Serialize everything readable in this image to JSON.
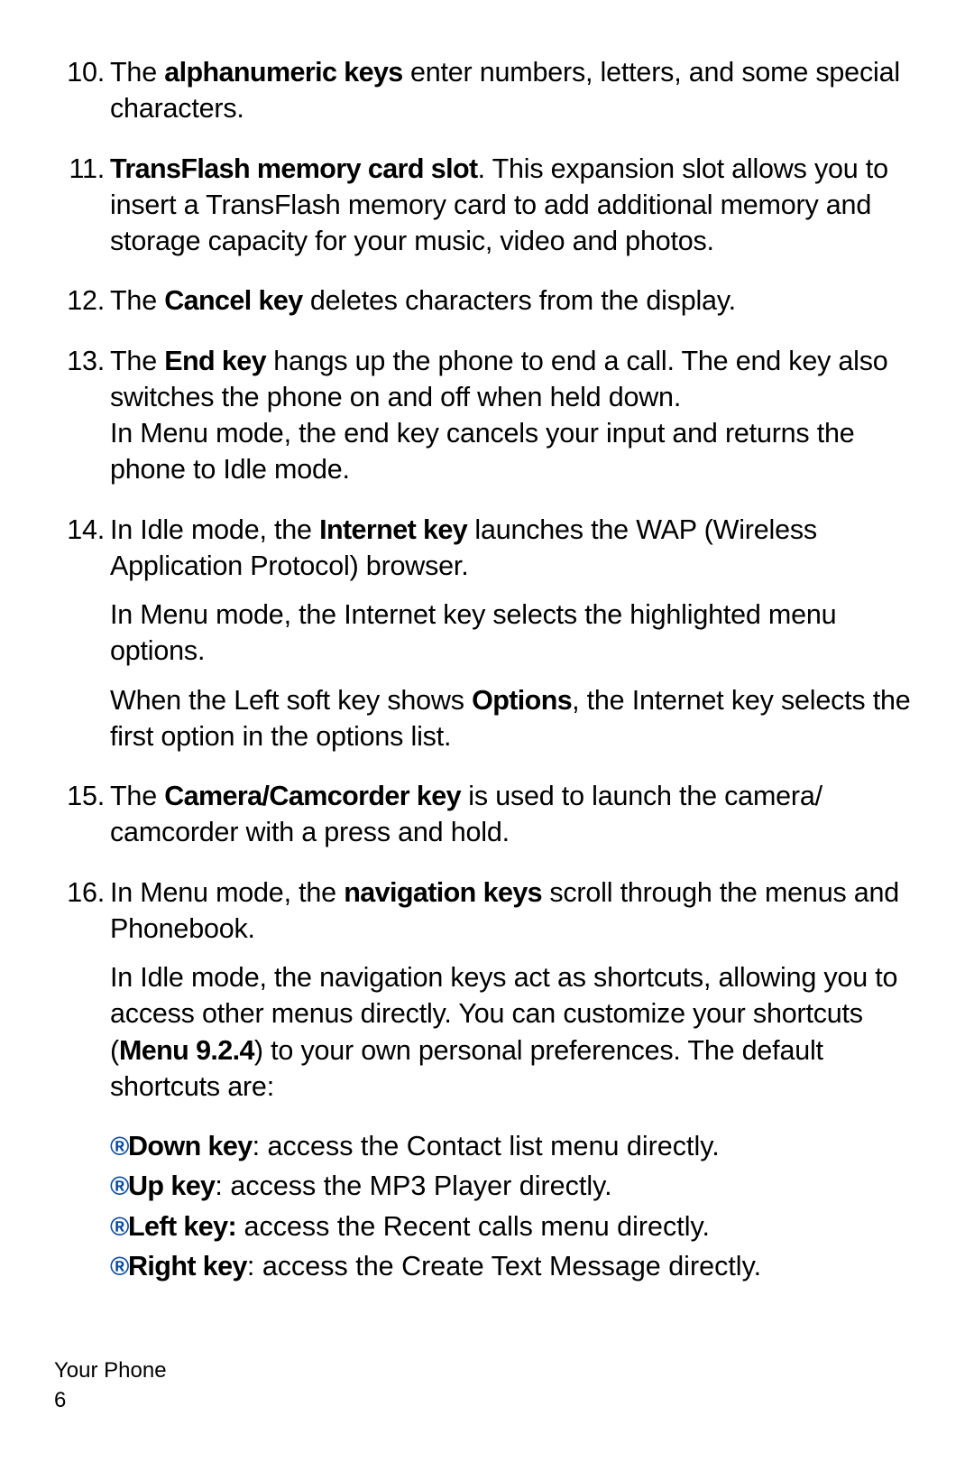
{
  "items": [
    {
      "num": 10,
      "frags": [
        {
          "t": "The "
        },
        {
          "t": "alphanumeric keys",
          "b": true,
          "cond": true
        },
        {
          "t": " enter numbers, letters, and some special characters."
        }
      ]
    },
    {
      "num": 11,
      "frags": [
        {
          "t": "TransFlash memory card slot",
          "b": true,
          "cond": true
        },
        {
          "t": ". This expansion slot allows you to insert a TransFlash memory card to add additional memory and storage capacity for your music, video and photos."
        }
      ]
    },
    {
      "num": 12,
      "frags": [
        {
          "t": "The "
        },
        {
          "t": "Cancel key",
          "b": true,
          "cond": true
        },
        {
          "t": " deletes characters from the display."
        }
      ]
    },
    {
      "num": 13,
      "frags": [
        {
          "t": "The "
        },
        {
          "t": "End key",
          "b": true,
          "cond": true
        },
        {
          "t": " hangs up the phone to end a call. The end key also switches the phone on and off when held down."
        },
        {
          "br": true
        },
        {
          "t": "In Menu mode, the end key cancels your input and returns the phone to Idle mode."
        }
      ]
    },
    {
      "num": 14,
      "frags": [
        {
          "t": "In Idle mode, the "
        },
        {
          "t": "Internet key",
          "b": true,
          "cond": true
        },
        {
          "t": " launches the WAP (Wireless Application Protocol) browser."
        }
      ],
      "paras": [
        [
          {
            "t": "In Menu mode, the Internet key selects the highlighted menu options."
          }
        ],
        [
          {
            "t": "When the Left soft key shows "
          },
          {
            "t": "Options",
            "b": true,
            "cond": true
          },
          {
            "t": ", the Internet key selects the first option in the options list."
          }
        ]
      ]
    },
    {
      "num": 15,
      "frags": [
        {
          "t": "The "
        },
        {
          "t": "Camera/Camcorder key",
          "b": true,
          "cond": true
        },
        {
          "t": " is used to launch the camera/"
        },
        {
          "br": true
        },
        {
          "t": "camcorder with a press and hold."
        }
      ]
    },
    {
      "num": 16,
      "frags": [
        {
          "t": "In Menu mode, the "
        },
        {
          "t": "navigation keys",
          "b": true,
          "cond": true
        },
        {
          "t": " scroll through the menus and Phonebook."
        }
      ],
      "paras": [
        [
          {
            "t": "In Idle mode, the navigation keys act as shortcuts, allowing you to access other menus directly. You can customize your shortcuts ("
          },
          {
            "t": "Menu 9.2.4",
            "b": true,
            "cond": true
          },
          {
            "t": ") to your own personal preferences. The default shortcuts are:"
          }
        ]
      ]
    }
  ],
  "shortcuts": [
    {
      "label": "Down key",
      "desc": ": access the Contact list menu directly."
    },
    {
      "label": "Up key",
      "desc": ": access the MP3 Player directly."
    },
    {
      "label": "Left key:",
      "desc": " access the Recent calls menu directly."
    },
    {
      "label": "Right key",
      "desc": ": access the Create Text Message directly."
    }
  ],
  "footer": {
    "section": "Your Phone",
    "page": "6"
  },
  "bullet_char": "®"
}
